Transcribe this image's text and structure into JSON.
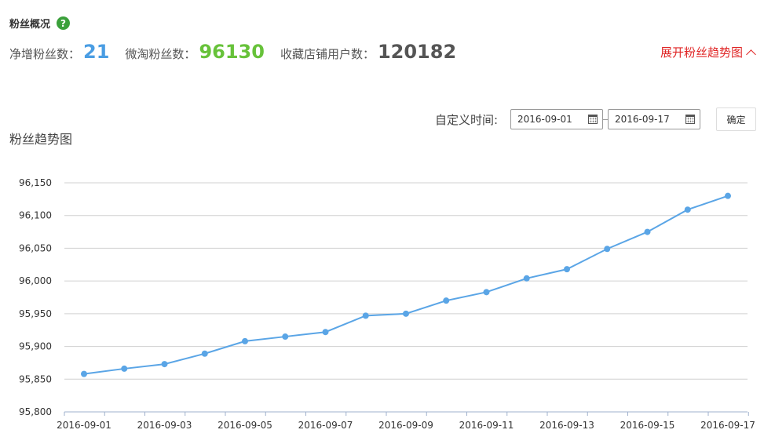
{
  "header": {
    "title": "粉丝概况",
    "help_icon": "question-icon",
    "help_symbol": "?"
  },
  "stats": [
    {
      "label": "净增粉丝数：",
      "value": "21",
      "color": "#4a9de3"
    },
    {
      "label": "微淘粉丝数：",
      "value": "96130",
      "color": "#67c23a"
    },
    {
      "label": "收藏店铺用户数：",
      "value": "120182",
      "color": "#555555"
    }
  ],
  "expand_link": {
    "label": "展开粉丝趋势图",
    "icon": "chevron-up-icon"
  },
  "date_filter": {
    "label": "自定义时间:",
    "start": "2016-09-01",
    "end": "2016-09-17",
    "calendar_icon": "calendar-icon",
    "confirm_label": "确定"
  },
  "chart_data": {
    "type": "line",
    "title": "粉丝趋势图",
    "xlabel": "",
    "ylabel": "",
    "x": [
      "2016-09-01",
      "2016-09-02",
      "2016-09-03",
      "2016-09-04",
      "2016-09-05",
      "2016-09-06",
      "2016-09-07",
      "2016-09-08",
      "2016-09-09",
      "2016-09-10",
      "2016-09-11",
      "2016-09-12",
      "2016-09-13",
      "2016-09-14",
      "2016-09-15",
      "2016-09-16",
      "2016-09-17"
    ],
    "x_tick_labels": [
      "2016-09-01",
      "2016-09-03",
      "2016-09-05",
      "2016-09-07",
      "2016-09-09",
      "2016-09-11",
      "2016-09-13",
      "2016-09-15",
      "2016-09-17"
    ],
    "series": [
      {
        "values": [
          95858,
          95866,
          95873,
          95889,
          95908,
          95915,
          95922,
          95947,
          95950,
          95970,
          95983,
          96004,
          96018,
          96049,
          96075,
          96109,
          96130
        ],
        "color": "#5aa5e6"
      }
    ],
    "ylim": [
      95800,
      96150
    ],
    "y_ticks": [
      95800,
      95850,
      95900,
      95950,
      96000,
      96050,
      96100,
      96150
    ],
    "y_tick_labels": [
      "95,800",
      "95,850",
      "95,900",
      "95,950",
      "96,000",
      "96,050",
      "96,100",
      "96,150"
    ],
    "grid": true
  }
}
